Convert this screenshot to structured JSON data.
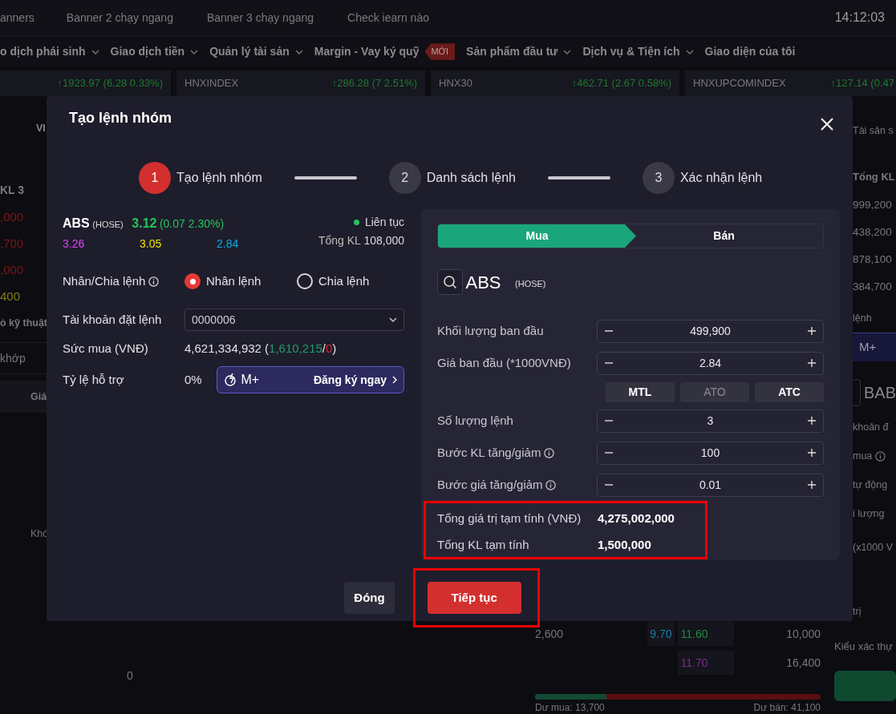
{
  "top_bar": {
    "banners": [
      "anners",
      "Banner 2 chạy ngang",
      "Banner 3 chạy ngang",
      "Check iearn nào"
    ],
    "clock": "14:12:03"
  },
  "menu": [
    {
      "label": "o dịch phái sinh",
      "dropdown": true
    },
    {
      "label": "Giao dịch tiền",
      "dropdown": true
    },
    {
      "label": "Quản lý tài sản",
      "dropdown": true
    },
    {
      "label": "Margin - Vay ký quỹ",
      "dropdown": false,
      "badge": "MỚI"
    },
    {
      "label": "Sản phẩm đầu tư",
      "dropdown": true
    },
    {
      "label": "Dịch vụ & Tiện ích",
      "dropdown": true
    },
    {
      "label": "Giao diện của tôi",
      "dropdown": false
    }
  ],
  "indices": [
    {
      "change": "↑1923.97 (6.28 0.33%)"
    },
    {
      "name": "HNXINDEX",
      "change": "↑286.28 (7 2.51%)"
    },
    {
      "name": "HNX30",
      "change": "↑462.71 (2.67 0.58%)"
    },
    {
      "name": "HNXUPCOMINDEX",
      "change": "↑127.14 (0.47"
    }
  ],
  "left_panel": {
    "tab": "VI",
    "column_header": "KL 3",
    "cells": [
      {
        "text": ",000",
        "kind": "down"
      },
      {
        "text": ",700",
        "kind": "down"
      },
      {
        "text": ",000",
        "kind": "down"
      },
      {
        "text": "400",
        "kind": "ref"
      }
    ],
    "section_title": "ỏ kỹ thuật",
    "filter": "khớp",
    "table_header": "Giá",
    "label": "Khó"
  },
  "right_panel": {
    "tab": "Tài sản s",
    "column_header": "Tổng KL",
    "cells": [
      "999,200",
      "438,200",
      "878,100",
      "384,700"
    ],
    "section_title": "lệnh",
    "product": "M+",
    "symbol": "BAB",
    "labels": [
      {
        "text": "khoản đ",
        "info": false
      },
      {
        "text": "mua",
        "info": true
      },
      {
        "text": "tự động",
        "info": false
      },
      {
        "text": "i lượng",
        "info": false
      },
      {
        "text": "(x1000 V",
        "info": false
      },
      {
        "text": "trị",
        "info": false
      }
    ],
    "confirm_label": "Kiểu xác thự"
  },
  "chart_area": {
    "value": "0"
  },
  "order_book": {
    "rows": [
      {
        "volume": "2,600",
        "bid": {
          "text": "9.70",
          "color": "#1a7fa6"
        },
        "ask": {
          "text": "11.60",
          "color": "#1f8a3a"
        },
        "ask_volume": "10,000"
      },
      {
        "ask": {
          "text": "11.70",
          "color": "#7a2a8a"
        },
        "ask_volume": "16,400"
      }
    ],
    "level": 0.25,
    "buy_surplus": "Dư mua: 13,700",
    "sell_surplus": "Dư bán: 41,100"
  },
  "modal": {
    "title": "Tạo lệnh nhóm",
    "steps": [
      {
        "number": "1",
        "label": "Tạo lệnh nhóm",
        "selected": true
      },
      {
        "number": "2",
        "label": "Danh sách lệnh",
        "selected": false
      },
      {
        "number": "3",
        "label": "Xác nhận lệnh",
        "selected": false
      }
    ],
    "stock": {
      "symbol": "ABS",
      "exchange": "(HOSE)",
      "price": "3.12",
      "change": "(0.07 2.30%)",
      "ceiling": "3.26",
      "reference": "3.05",
      "floor": "2.84",
      "session": "Liên tục",
      "total_volume_label": "Tổng KL",
      "total_volume": "108,000"
    },
    "mode": {
      "label": "Nhân/Chia lệnh",
      "options": [
        {
          "label": "Nhân lệnh",
          "selected": true
        },
        {
          "label": "Chia lệnh",
          "selected": false
        }
      ]
    },
    "account": {
      "label": "Tài khoản đặt lệnh",
      "value": "0000006"
    },
    "buying_power": {
      "label": "Sức mua (VNĐ)",
      "parts": [
        {
          "text": "4,621,334,932 (",
          "kind": "plain"
        },
        {
          "text": "1,610,215",
          "kind": "positive"
        },
        {
          "text": "/",
          "kind": "plain"
        },
        {
          "text": "0",
          "kind": "negative"
        },
        {
          "text": ")",
          "kind": "plain"
        }
      ]
    },
    "support": {
      "label": "Tỷ lệ hỗ trợ",
      "value": "0%",
      "product": "M+",
      "action": "Đăng ký ngay"
    },
    "side_tabs": [
      {
        "label": "Mua",
        "selected": true
      },
      {
        "label": "Bán",
        "selected": false
      }
    ],
    "symbol_search": {
      "symbol": "ABS",
      "exchange": "(HOSE)"
    },
    "fields": [
      {
        "label": "Khối lượng ban đầu",
        "value": "499,900",
        "info": false
      },
      {
        "label": "Giá ban đầu (*1000VNĐ)",
        "value": "2.84",
        "info": false,
        "price_types": [
          {
            "label": "MTL",
            "disabled": false
          },
          {
            "label": "ATO",
            "disabled": true
          },
          {
            "label": "ATC",
            "disabled": false
          }
        ]
      },
      {
        "label": "Số lượng lệnh",
        "value": "3",
        "info": false
      },
      {
        "label": "Bước KL tăng/giảm",
        "value": "100",
        "info": true
      },
      {
        "label": "Bước giá tăng/giảm",
        "value": "0.01",
        "info": true
      }
    ],
    "totals": {
      "highlighted": true,
      "rows": [
        {
          "label": "Tổng giá trị tạm tính (VNĐ)",
          "value": "4,275,002,000"
        },
        {
          "label": "Tổng KL tạm tính",
          "value": "1,500,000"
        }
      ]
    },
    "buttons": [
      {
        "label": "Đóng",
        "kind": "secondary",
        "highlighted": false
      },
      {
        "label": "Tiếp tục",
        "kind": "primary",
        "highlighted": true
      }
    ]
  }
}
